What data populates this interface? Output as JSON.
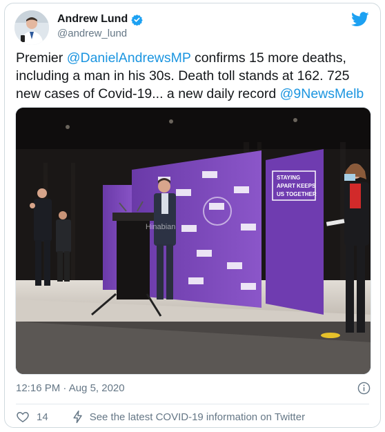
{
  "author": {
    "name": "Andrew Lund",
    "handle": "@andrew_lund",
    "verified": true,
    "avatar_icon": "avatar-photo"
  },
  "platform_icon": "twitter-bird-icon",
  "brand_color": "#1da1f2",
  "link_color": "#1b95e0",
  "tweet": {
    "t1": "Premier ",
    "m1": "@DanielAndrewsMP",
    "t2": " confirms 15 more deaths, including a man in his 30s. Death toll stands at 162. 725 new cases of Covid-19... a new daily record ",
    "m2": "@9NewsMelb"
  },
  "media": {
    "type": "photo",
    "banner_text": [
      "STAYING",
      "APART KEEPS",
      "US TOGETHER"
    ],
    "watermark": "Hinabian"
  },
  "meta": {
    "timestamp": "12:16 PM · Aug 5, 2020"
  },
  "actions": {
    "like_count": "14",
    "covid_link": "See the latest COVID-19 information on Twitter"
  }
}
